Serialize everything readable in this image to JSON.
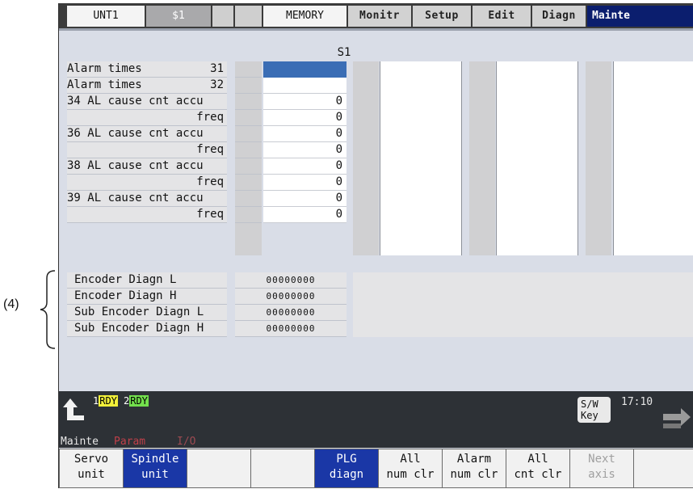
{
  "annotation": "(4)",
  "header": {
    "unit": "UNT1",
    "system": "$1",
    "mode": "MEMORY",
    "menu_tabs": [
      "Monitr",
      "Setup",
      "Edit",
      "Diagn",
      "Mainte"
    ],
    "active_tab": "Mainte"
  },
  "table": {
    "column_header": "S1",
    "rows": [
      {
        "label": "Alarm times",
        "suffix": "31",
        "value": ""
      },
      {
        "label": "Alarm times",
        "suffix": "32",
        "value": ""
      },
      {
        "label": "34 AL cause cnt accu",
        "suffix": "",
        "value": "0"
      },
      {
        "label": "",
        "suffix": "freq",
        "value": "0"
      },
      {
        "label": "36 AL cause cnt accu",
        "suffix": "",
        "value": "0"
      },
      {
        "label": "",
        "suffix": "freq",
        "value": "0"
      },
      {
        "label": "38 AL cause cnt accu",
        "suffix": "",
        "value": "0"
      },
      {
        "label": "",
        "suffix": "freq",
        "value": "0"
      },
      {
        "label": "39 AL cause cnt accu",
        "suffix": "",
        "value": "0"
      },
      {
        "label": "",
        "suffix": "freq",
        "value": "0"
      }
    ]
  },
  "encoder": [
    {
      "label": "Encoder Diagn L",
      "value": "00000000"
    },
    {
      "label": "Encoder Diagn H",
      "value": "00000000"
    },
    {
      "label": "Sub Encoder Diagn L",
      "value": "00000000"
    },
    {
      "label": "Sub Encoder Diagn H",
      "value": "00000000"
    }
  ],
  "status": {
    "rdy1_num": "1",
    "rdy1": "RDY",
    "rdy2_num": "2",
    "rdy2": "RDY",
    "swkey_line1": "S/W",
    "swkey_line2": "Key",
    "time": "17:10",
    "mode_label": "Mainte",
    "param_label": "Param",
    "io_label": "I/O"
  },
  "softkeys": [
    {
      "line1": "Servo",
      "line2": "unit"
    },
    {
      "line1": "Spindle",
      "line2": "unit"
    },
    {
      "line1": "",
      "line2": ""
    },
    {
      "line1": "",
      "line2": ""
    },
    {
      "line1": "PLG",
      "line2": "diagn"
    },
    {
      "line1": "All",
      "line2": "num clr"
    },
    {
      "line1": "Alarm",
      "line2": "num clr"
    },
    {
      "line1": "All",
      "line2": "cnt clr"
    },
    {
      "line1": "Next",
      "line2": "axis"
    },
    {
      "line1": "",
      "line2": ""
    }
  ],
  "colors": {
    "active_tab": "#0b1e6e",
    "softkey_blue": "#1a37a6",
    "selected_cell": "#3a6db5",
    "rdy1_bg": "#f2f03a",
    "rdy2_bg": "#73e04d",
    "param_text": "#c0404a"
  }
}
